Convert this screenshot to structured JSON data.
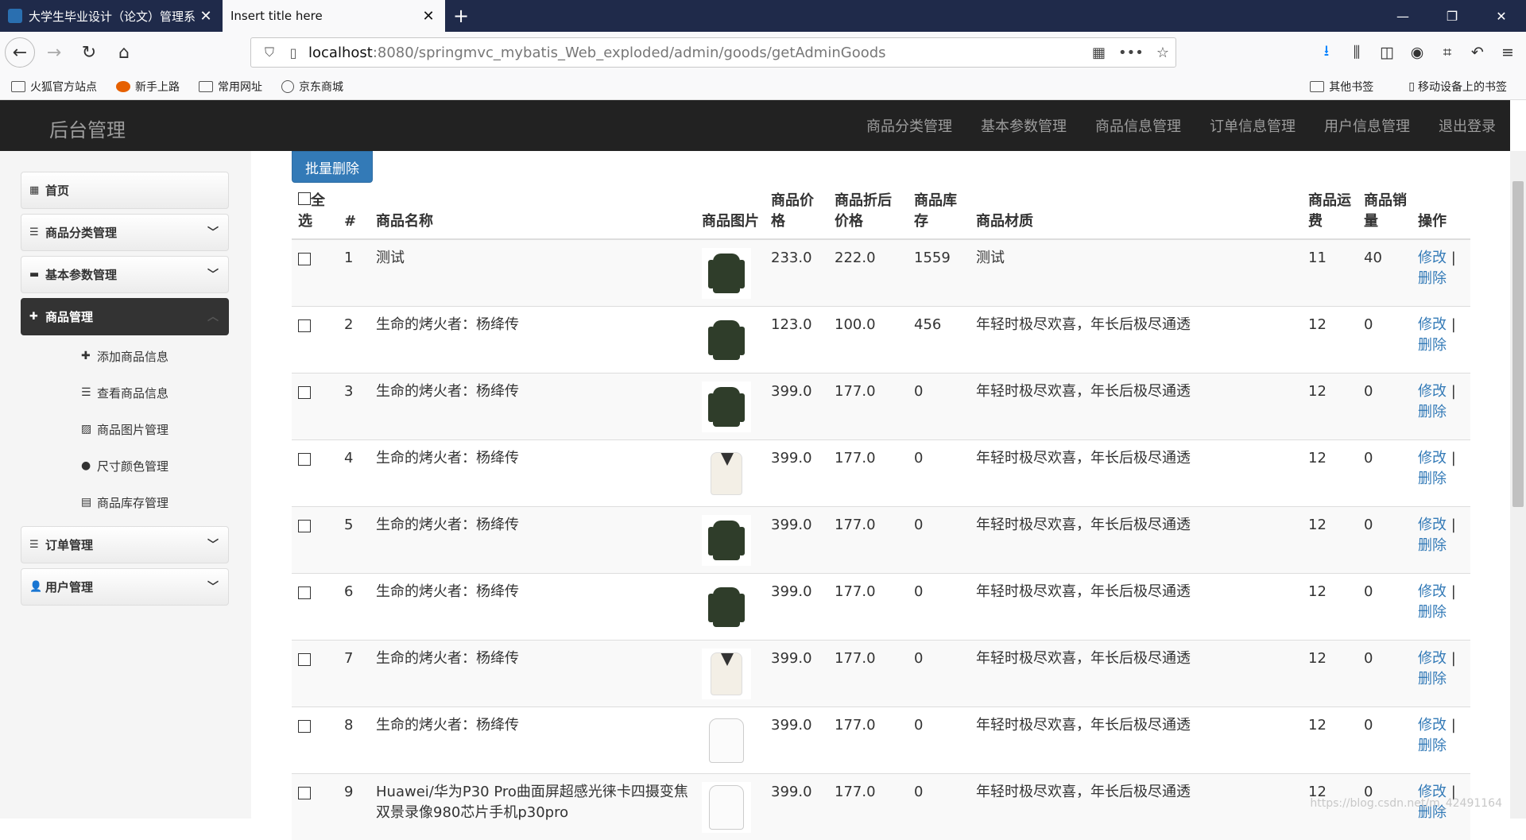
{
  "browser": {
    "tabs": [
      {
        "title": "大学生毕业设计（论文）管理系",
        "active": false
      },
      {
        "title": "Insert title here",
        "active": true
      }
    ],
    "url_host": "localhost",
    "url_rest": ":8080/springmvc_mybatis_Web_exploded/admin/goods/getAdminGoods",
    "bookmarks": [
      "火狐官方站点",
      "新手上路",
      "常用网址",
      "京东商城"
    ],
    "bookmarks_right": [
      "其他书签",
      "移动设备上的书签"
    ]
  },
  "app": {
    "brand": "后台管理",
    "topnav": [
      "商品分类管理",
      "基本参数管理",
      "商品信息管理",
      "订单信息管理",
      "用户信息管理",
      "退出登录"
    ]
  },
  "sidebar": {
    "items": [
      {
        "label": "首页",
        "icon": "grid-icon"
      },
      {
        "label": "商品分类管理",
        "icon": "list-icon"
      },
      {
        "label": "基本参数管理",
        "icon": "briefcase-icon"
      },
      {
        "label": "商品管理",
        "icon": "gift-icon",
        "active": true
      },
      {
        "label": "订单管理",
        "icon": "menu-icon"
      },
      {
        "label": "用户管理",
        "icon": "user-icon"
      }
    ],
    "sub_items": [
      {
        "label": "添加商品信息",
        "icon": "plus-icon"
      },
      {
        "label": "查看商品信息",
        "icon": "list-icon"
      },
      {
        "label": "商品图片管理",
        "icon": "picture-icon"
      },
      {
        "label": "尺寸颜色管理",
        "icon": "tint-icon"
      },
      {
        "label": "商品库存管理",
        "icon": "stack-icon"
      }
    ]
  },
  "main": {
    "batch_delete_label": "批量删除",
    "columns": {
      "select_all": "全选",
      "index": "#",
      "name": "商品名称",
      "image": "商品图片",
      "price": "商品价格",
      "discount_price": "商品折后价格",
      "stock": "商品库存",
      "material": "商品材质",
      "shipping": "商品运费",
      "sales": "商品销量",
      "actions": "操作"
    },
    "edit_label": "修改",
    "separator": "|",
    "delete_label": "删除",
    "rows": [
      {
        "index": "1",
        "name": "测试",
        "image": "jacket",
        "price": "233.0",
        "discount": "222.0",
        "stock": "1559",
        "material": "测试",
        "shipping": "11",
        "sales": "40"
      },
      {
        "index": "2",
        "name": "生命的烤火者：杨绛传",
        "image": "jacket",
        "price": "123.0",
        "discount": "100.0",
        "stock": "456",
        "material": "年轻时极尽欢喜，年长后极尽通透",
        "shipping": "12",
        "sales": "0"
      },
      {
        "index": "3",
        "name": "生命的烤火者：杨绛传",
        "image": "jacket",
        "price": "399.0",
        "discount": "177.0",
        "stock": "0",
        "material": "年轻时极尽欢喜，年长后极尽通透",
        "shipping": "12",
        "sales": "0"
      },
      {
        "index": "4",
        "name": "生命的烤火者：杨绛传",
        "image": "sweater",
        "price": "399.0",
        "discount": "177.0",
        "stock": "0",
        "material": "年轻时极尽欢喜，年长后极尽通透",
        "shipping": "12",
        "sales": "0"
      },
      {
        "index": "5",
        "name": "生命的烤火者：杨绛传",
        "image": "jacket",
        "price": "399.0",
        "discount": "177.0",
        "stock": "0",
        "material": "年轻时极尽欢喜，年长后极尽通透",
        "shipping": "12",
        "sales": "0"
      },
      {
        "index": "6",
        "name": "生命的烤火者：杨绛传",
        "image": "jacket",
        "price": "399.0",
        "discount": "177.0",
        "stock": "0",
        "material": "年轻时极尽欢喜，年长后极尽通透",
        "shipping": "12",
        "sales": "0"
      },
      {
        "index": "7",
        "name": "生命的烤火者：杨绛传",
        "image": "sweater",
        "price": "399.0",
        "discount": "177.0",
        "stock": "0",
        "material": "年轻时极尽欢喜，年长后极尽通透",
        "shipping": "12",
        "sales": "0"
      },
      {
        "index": "8",
        "name": "生命的烤火者：杨绛传",
        "image": "shirt",
        "price": "399.0",
        "discount": "177.0",
        "stock": "0",
        "material": "年轻时极尽欢喜，年长后极尽通透",
        "shipping": "12",
        "sales": "0"
      },
      {
        "index": "9",
        "name": "Huawei/华为P30 Pro曲面屏超感光徕卡四摄变焦双景录像980芯片手机p30pro",
        "image": "shirt",
        "price": "399.0",
        "discount": "177.0",
        "stock": "0",
        "material": "年轻时极尽欢喜，年长后极尽通透",
        "shipping": "12",
        "sales": "0"
      }
    ]
  },
  "watermark": "https://blog.csdn.net/m_42491164"
}
